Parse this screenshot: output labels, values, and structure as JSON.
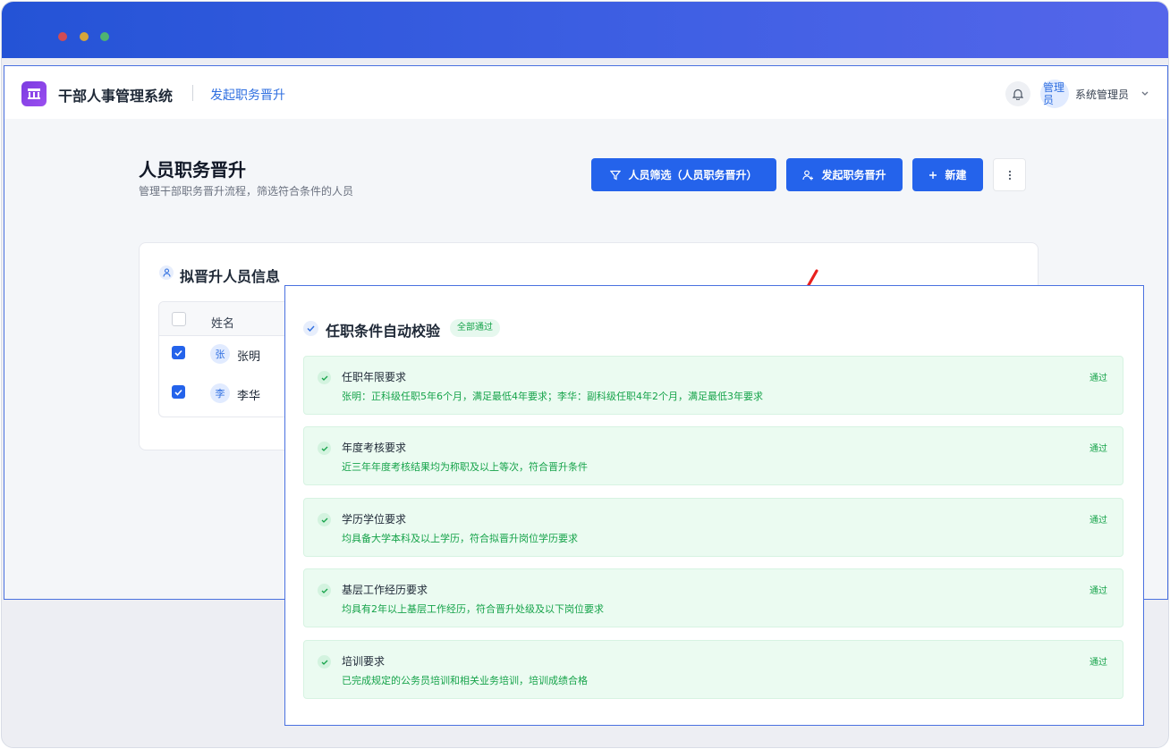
{
  "app": {
    "title": "干部人事管理系统",
    "breadcrumb": "发起职务晋升",
    "user_avatar": "管理员",
    "user_name": "系统管理员"
  },
  "page": {
    "title": "人员职务晋升",
    "subtitle": "管理干部职务晋升流程，筛选符合条件的人员"
  },
  "toolbar": {
    "filter_label": "人员筛选（人员职务晋升）",
    "promote_label": "发起职务晋升",
    "new_label": "新建"
  },
  "card": {
    "title": "拟晋升人员信息",
    "column_name": "姓名",
    "rows": [
      {
        "avatar": "张",
        "name": "张明",
        "checked": true
      },
      {
        "avatar": "李",
        "name": "李华",
        "checked": true
      }
    ]
  },
  "validation": {
    "title": "任职条件自动校验",
    "badge": "全部通过",
    "items": [
      {
        "title": "任职年限要求",
        "detail": "张明：正科级任职5年6个月，满足最低4年要求；李华：副科级任职4年2个月，满足最低3年要求",
        "status": "通过"
      },
      {
        "title": "年度考核要求",
        "detail": "近三年年度考核结果均为称职及以上等次，符合晋升条件",
        "status": "通过"
      },
      {
        "title": "学历学位要求",
        "detail": "均具备大学本科及以上学历，符合拟晋升岗位学历要求",
        "status": "通过"
      },
      {
        "title": "基层工作经历要求",
        "detail": "均具有2年以上基层工作经历，符合晋升处级及以下岗位要求",
        "status": "通过"
      },
      {
        "title": "培训要求",
        "detail": "已完成规定的公务员培训和相关业务培训，培训成绩合格",
        "status": "通过"
      }
    ]
  },
  "colors": {
    "primary": "#2463eb",
    "success": "#16a34a",
    "success_bg": "#ebfbf1",
    "annotation_arrow": "#e8201e"
  },
  "icons": [
    "window-close-dot",
    "building-icon",
    "bell-icon",
    "chevron-down-icon",
    "filter-icon",
    "user-plus-icon",
    "plus-icon",
    "more-vertical-icon",
    "user-icon",
    "checkbox-icon",
    "check-icon",
    "annotation-arrow"
  ]
}
